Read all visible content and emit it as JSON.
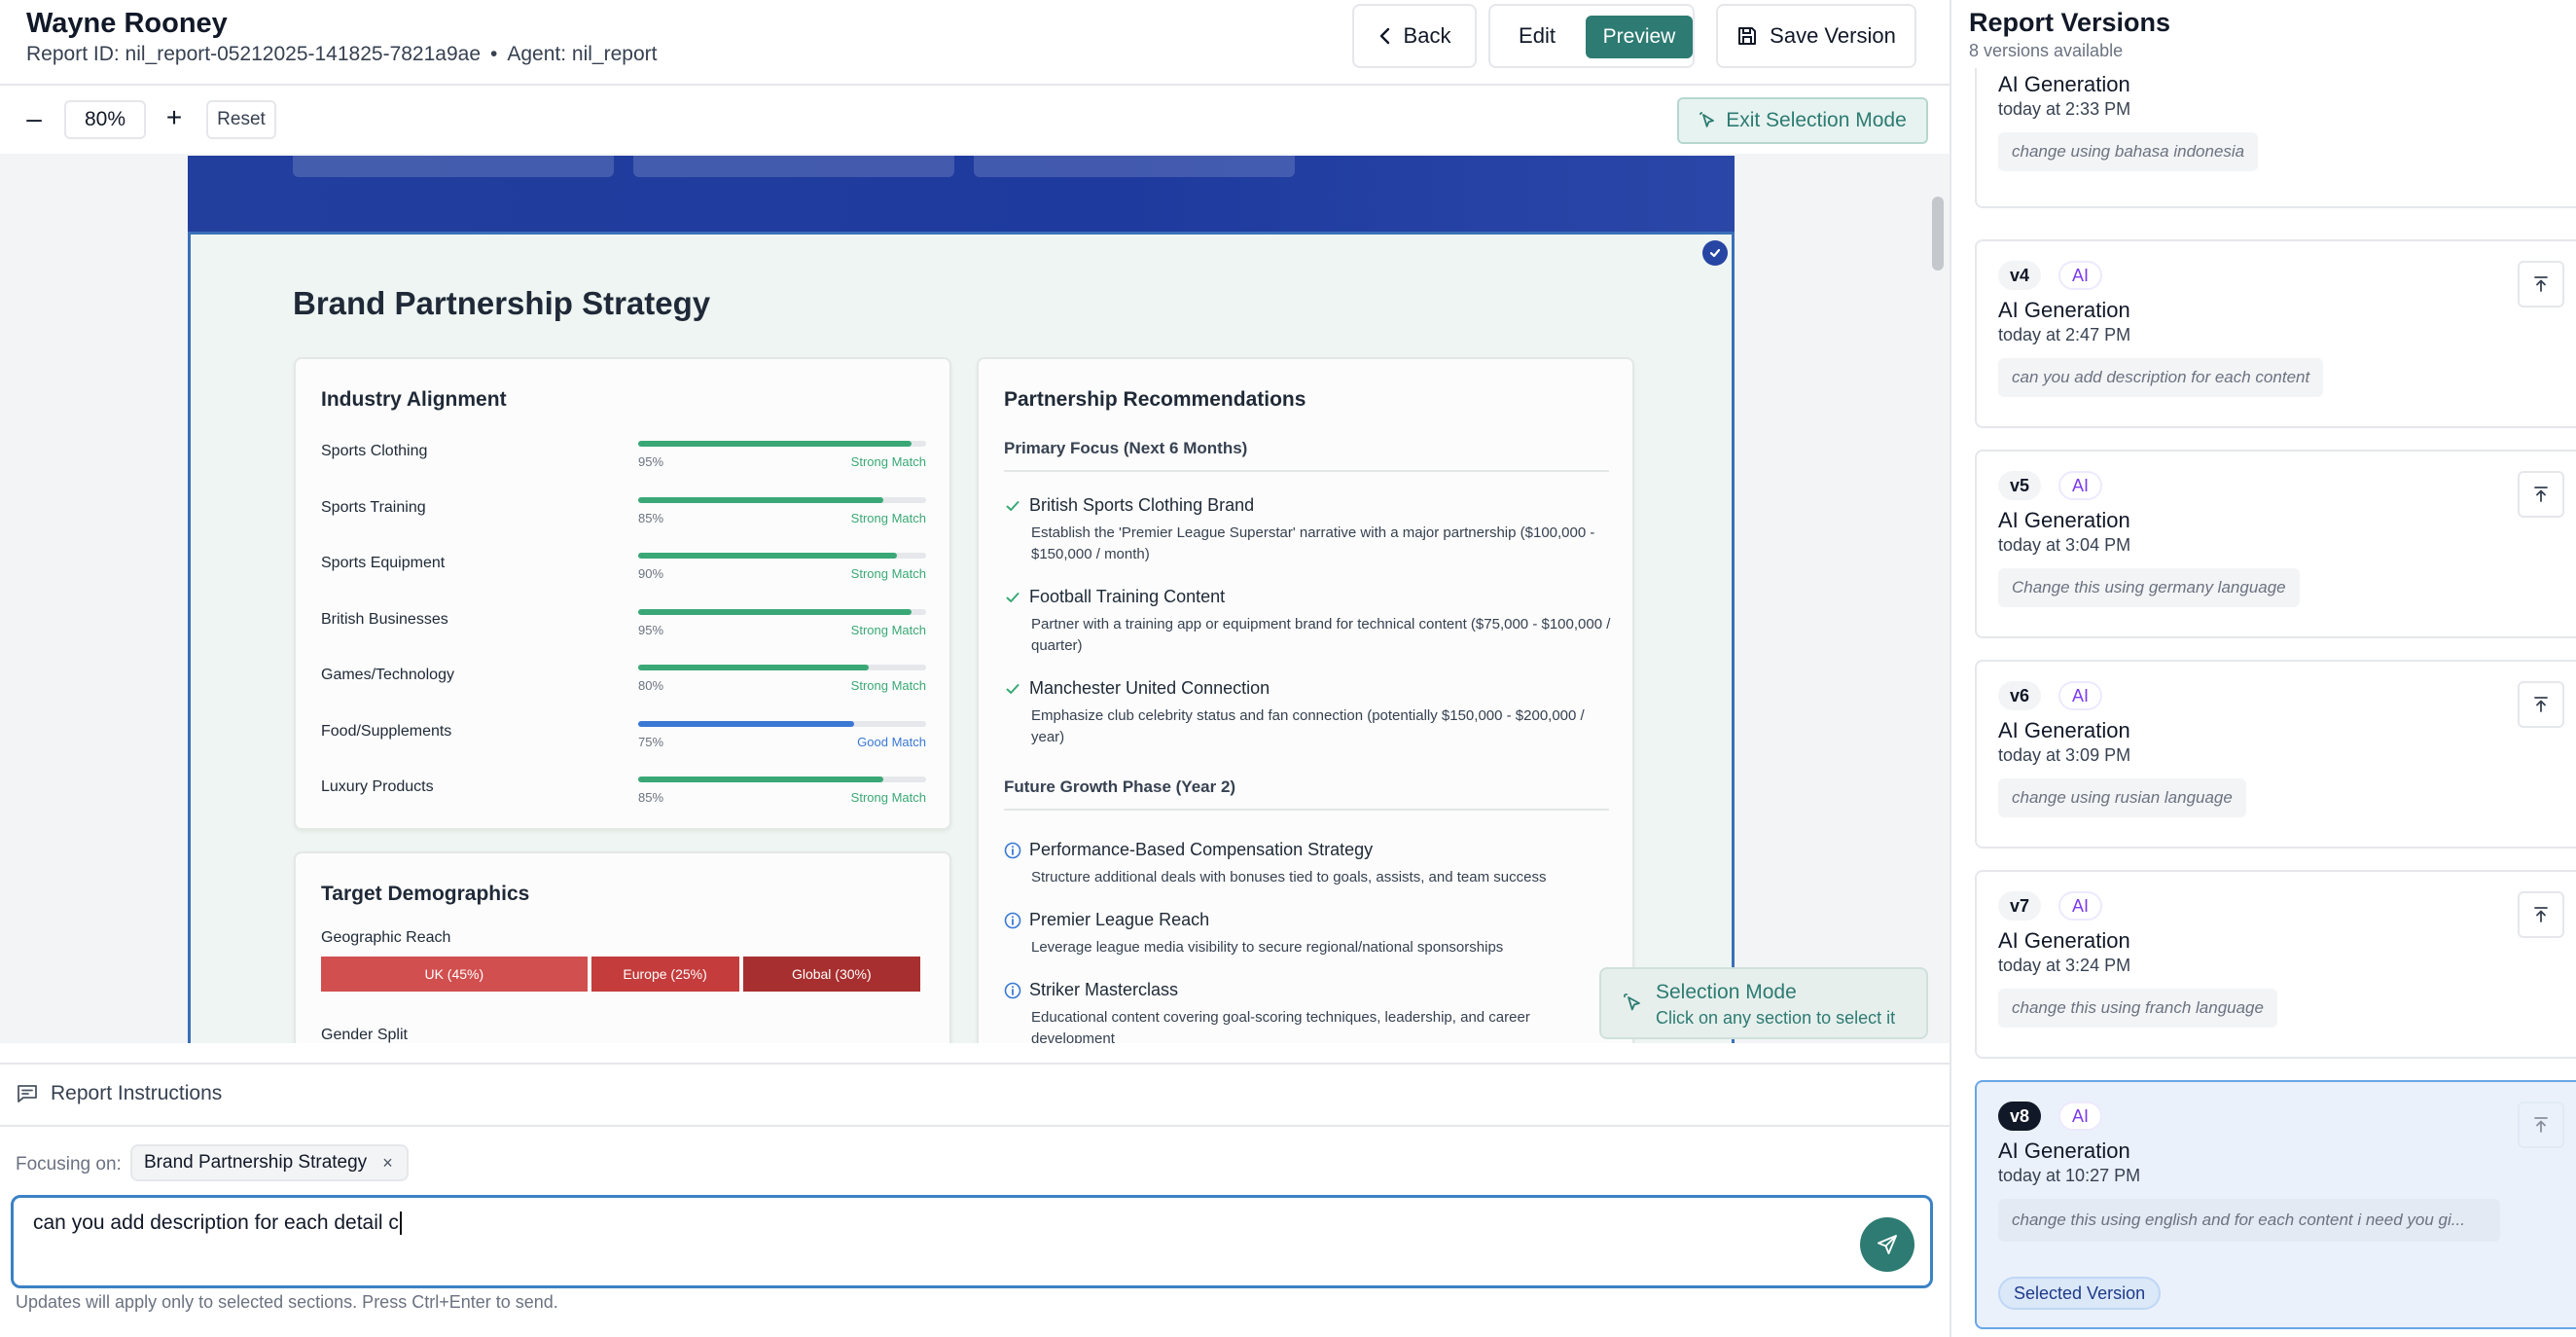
{
  "header": {
    "title": "Wayne Rooney",
    "report_id": "Report ID: nil_report-05212025-141825-7821a9ae",
    "separator": "•",
    "agent": "Agent: nil_report",
    "back_label": "Back",
    "edit_label": "Edit",
    "preview_label": "Preview",
    "save_label": "Save Version"
  },
  "toolbar": {
    "zoom": "80%",
    "reset_label": "Reset",
    "exit_selection_label": "Exit Selection Mode"
  },
  "section": {
    "title": "Brand Partnership Strategy",
    "industry": {
      "title": "Industry Alignment",
      "rows": [
        {
          "name": "Sports Clothing",
          "pct": "95%",
          "value": 0.95,
          "match": "Strong Match",
          "color": "#3aa876"
        },
        {
          "name": "Sports Training",
          "pct": "85%",
          "value": 0.85,
          "match": "Strong Match",
          "color": "#3aa876"
        },
        {
          "name": "Sports Equipment",
          "pct": "90%",
          "value": 0.9,
          "match": "Strong Match",
          "color": "#3aa876"
        },
        {
          "name": "British Businesses",
          "pct": "95%",
          "value": 0.95,
          "match": "Strong Match",
          "color": "#3aa876"
        },
        {
          "name": "Games/Technology",
          "pct": "80%",
          "value": 0.8,
          "match": "Strong Match",
          "color": "#3aa876"
        },
        {
          "name": "Food/Supplements",
          "pct": "75%",
          "value": 0.75,
          "match": "Good Match",
          "color": "#3a78d4"
        },
        {
          "name": "Luxury Products",
          "pct": "85%",
          "value": 0.85,
          "match": "Strong Match",
          "color": "#3aa876"
        }
      ]
    },
    "demographics": {
      "title": "Target Demographics",
      "geo_label": "Geographic Reach",
      "geo": [
        {
          "label": "UK (45%)",
          "value": 45,
          "color": "#d14f4f"
        },
        {
          "label": "Europe (25%)",
          "value": 25,
          "color": "#c43c3c"
        },
        {
          "label": "Global (30%)",
          "value": 30,
          "color": "#a82f2f"
        }
      ],
      "gender_label": "Gender Split"
    },
    "recommendations": {
      "title": "Partnership Recommendations",
      "primary_title": "Primary Focus (Next 6 Months)",
      "primary": [
        {
          "title": "British Sports Clothing Brand",
          "desc": "Establish the 'Premier League Superstar' narrative with a major partnership ($100,000 - $150,000 / month)"
        },
        {
          "title": "Football Training Content",
          "desc": "Partner with a training app or equipment brand for technical content ($75,000 - $100,000 / quarter)"
        },
        {
          "title": "Manchester United Connection",
          "desc": "Emphasize club celebrity status and fan connection (potentially $150,000 - $200,000 / year)"
        }
      ],
      "future_title": "Future Growth Phase (Year 2)",
      "future": [
        {
          "title": "Performance-Based Compensation Strategy",
          "desc": "Structure additional deals with bonuses tied to goals, assists, and team success"
        },
        {
          "title": "Premier League Reach",
          "desc": "Leverage league media visibility to secure regional/national sponsorships"
        },
        {
          "title": "Striker Masterclass",
          "desc": "Educational content covering goal-scoring techniques, leadership, and career development"
        }
      ]
    }
  },
  "selection_toast": {
    "title": "Selection Mode",
    "desc": "Click on any section to select it"
  },
  "instructions": {
    "title": "Report Instructions",
    "focus_label": "Focusing on:",
    "focus_chip": "Brand Partnership Strategy",
    "chip_close": "×",
    "input_value": "can you add description for each detail c",
    "hint": "Updates will apply only to selected sections. Press Ctrl+Enter to send."
  },
  "sidebar": {
    "title": "Report Versions",
    "count": "8 versions available",
    "versions": [
      {
        "tag": "",
        "ai": "",
        "title": "AI Generation",
        "time": "today at 2:33 PM",
        "prompt": "change using bahasa indonesia"
      },
      {
        "tag": "v4",
        "ai": "AI",
        "title": "AI Generation",
        "time": "today at 2:47 PM",
        "prompt": "can you add description for each content"
      },
      {
        "tag": "v5",
        "ai": "AI",
        "title": "AI Generation",
        "time": "today at 3:04 PM",
        "prompt": "Change this using germany language"
      },
      {
        "tag": "v6",
        "ai": "AI",
        "title": "AI Generation",
        "time": "today at 3:09 PM",
        "prompt": "change using rusian language"
      },
      {
        "tag": "v7",
        "ai": "AI",
        "title": "AI Generation",
        "time": "today at 3:24 PM",
        "prompt": "change this using franch language"
      },
      {
        "tag": "v8",
        "ai": "AI",
        "title": "AI Generation",
        "time": "today at 10:27 PM",
        "prompt": "change this using english and for each content i need you gi...",
        "selected_label": "Selected Version"
      }
    ]
  },
  "colors": {
    "accent": "#2d7b72",
    "doc_header": "#223f9e",
    "selection_border": "#3b6fb8",
    "ai_badge": "#7c3aed"
  }
}
